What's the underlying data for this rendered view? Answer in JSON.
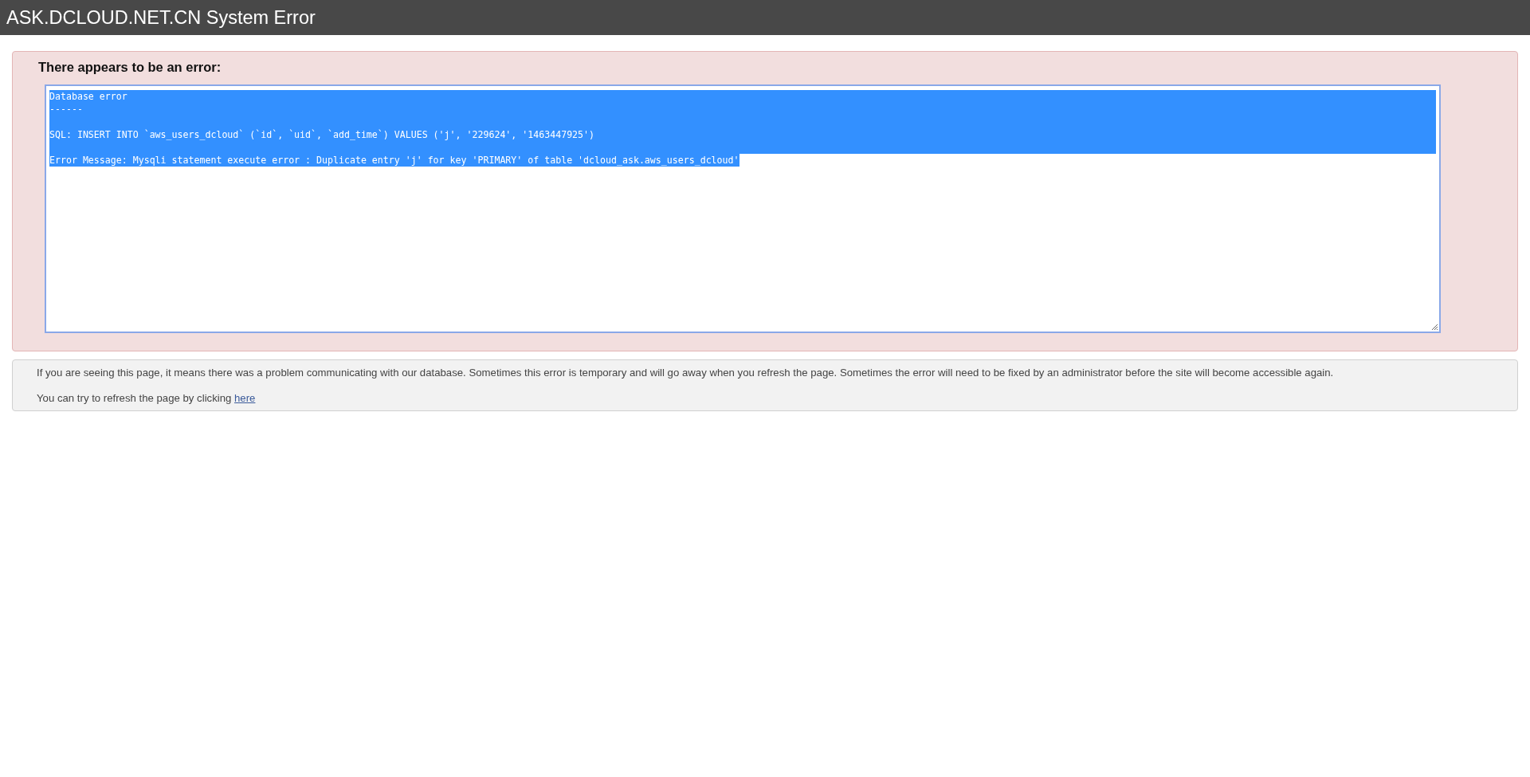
{
  "header": {
    "title": "ASK.DCLOUD.NET.CN System Error"
  },
  "error_panel": {
    "heading": "There appears to be an error:",
    "textarea": {
      "selected": true,
      "paragraphs": [
        [
          "Database error",
          "------"
        ],
        [
          "SQL: INSERT INTO `aws_users_dcloud` (`id`, `uid`, `add_time`) VALUES ('j', '229624', '1463447925')"
        ],
        [
          "Error Message: Mysqli statement execute error : Duplicate entry 'j' for key 'PRIMARY' of table 'dcloud_ask.aws_users_dcloud'"
        ]
      ]
    }
  },
  "info_panel": {
    "message": "If you are seeing this page, it means there was a problem communicating with our database. Sometimes this error is temporary and will go away when you refresh the page. Sometimes the error will need to be fixed by an administrator before the site will become accessible again.",
    "refresh_text": "You can try to refresh the page by clicking",
    "refresh_link": "here"
  }
}
